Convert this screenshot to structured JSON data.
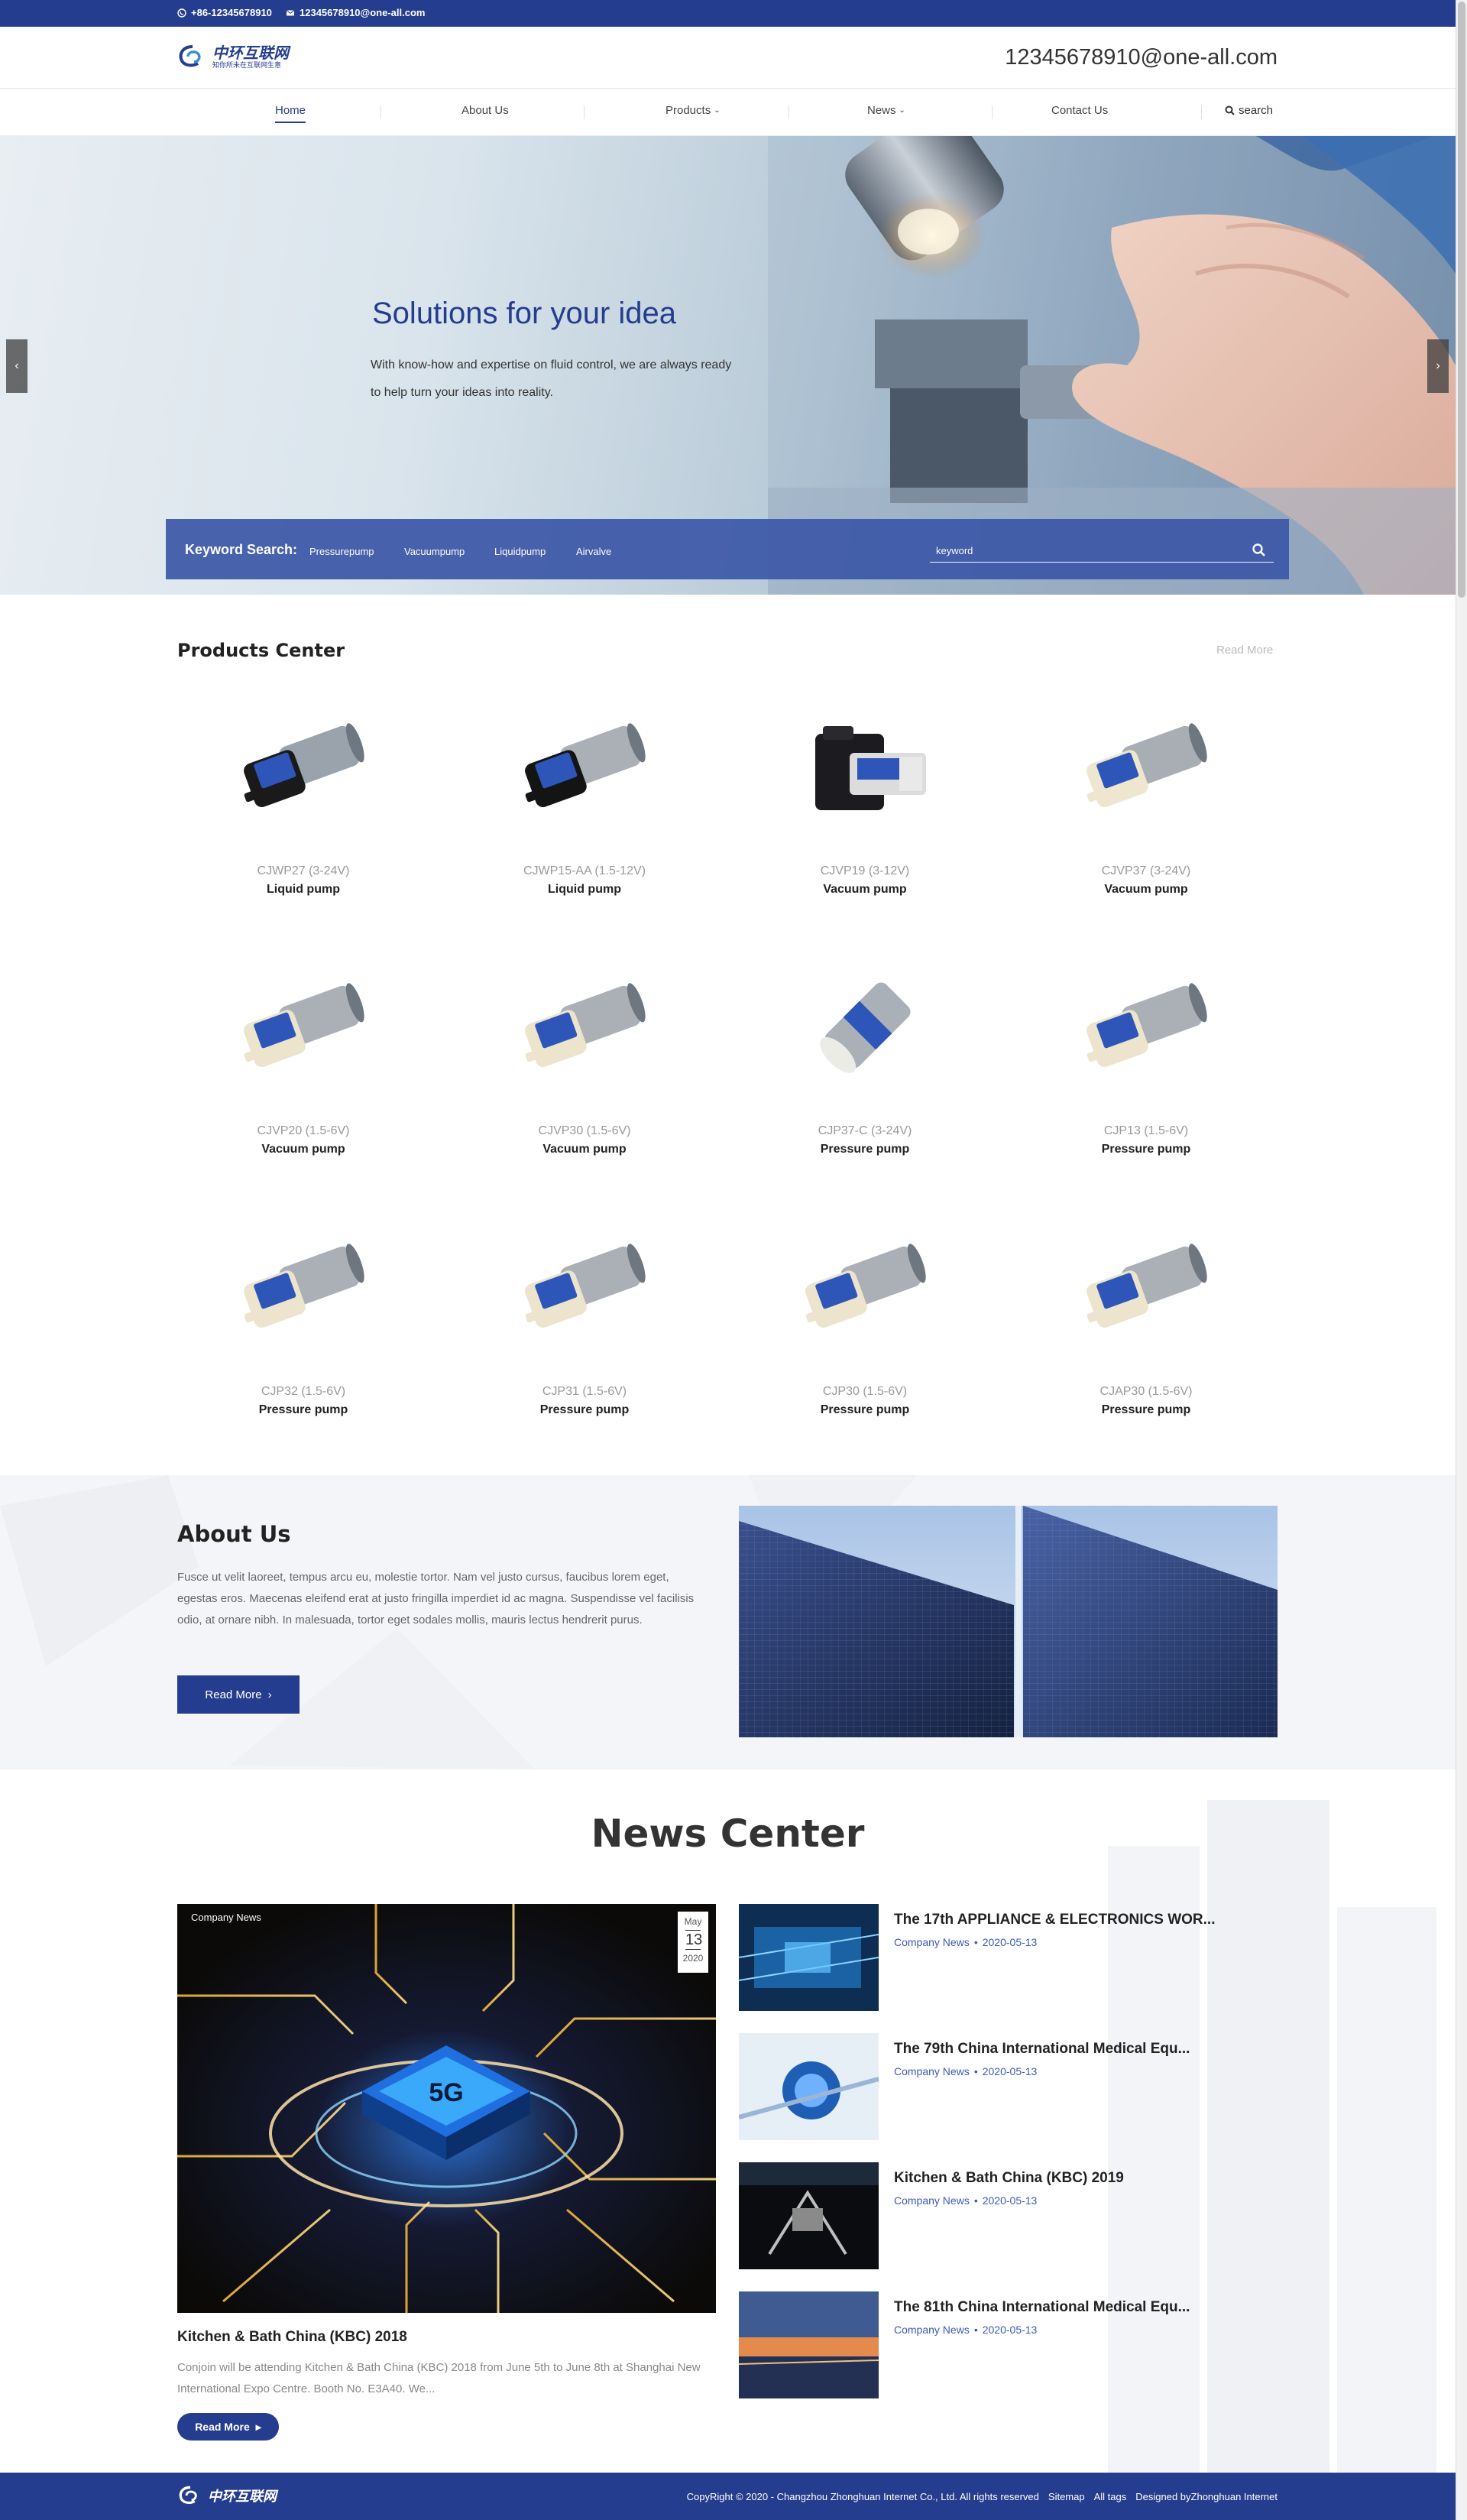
{
  "topbar": {
    "phone": "+86-12345678910",
    "email": "12345678910@one-all.com"
  },
  "header": {
    "logo_main": "中环互联网",
    "logo_sub": "知你所未在互联网生意",
    "email": "12345678910@one-all.com"
  },
  "nav": {
    "items": [
      {
        "label": "Home",
        "active": true
      },
      {
        "label": "About Us"
      },
      {
        "label": "Products",
        "has_dropdown": true
      },
      {
        "label": "News",
        "has_dropdown": true
      },
      {
        "label": "Contact Us"
      }
    ],
    "search_label": "search"
  },
  "hero": {
    "title": "Solutions for your idea",
    "text": "With know-how and expertise on fluid control, we are always ready to help turn your ideas into reality.",
    "keyword_label": "Keyword Search:",
    "keywords": [
      "Pressurepump",
      "Vacuumpump",
      "Liquidpump",
      "Airvalve"
    ],
    "search_placeholder": "keyword"
  },
  "products": {
    "title": "Products Center",
    "read_more": "Read More",
    "items": [
      {
        "model": "CJWP27 (3-24V)",
        "type": "Liquid pump"
      },
      {
        "model": "CJWP15-AA (1.5-12V)",
        "type": "Liquid pump"
      },
      {
        "model": "CJVP19 (3-12V)",
        "type": "Vacuum pump"
      },
      {
        "model": "CJVP37 (3-24V)",
        "type": "Vacuum pump"
      },
      {
        "model": "CJVP20 (1.5-6V)",
        "type": "Vacuum pump"
      },
      {
        "model": "CJVP30 (1.5-6V)",
        "type": "Vacuum pump"
      },
      {
        "model": "CJP37-C (3-24V)",
        "type": "Pressure pump"
      },
      {
        "model": "CJP13 (1.5-6V)",
        "type": "Pressure pump"
      },
      {
        "model": "CJP32 (1.5-6V)",
        "type": "Pressure pump"
      },
      {
        "model": "CJP31 (1.5-6V)",
        "type": "Pressure pump"
      },
      {
        "model": "CJP30 (1.5-6V)",
        "type": "Pressure pump"
      },
      {
        "model": "CJAP30 (1.5-6V)",
        "type": "Pressure pump"
      }
    ]
  },
  "about": {
    "title": "About Us",
    "text": "Fusce ut velit laoreet, tempus arcu eu, molestie tortor. Nam vel justo cursus, faucibus lorem eget, egestas eros. Maecenas eleifend erat at justo fringilla imperdiet id ac magna. Suspendisse vel facilisis odio, at ornare nibh. In malesuada, tortor eget sodales mollis, mauris lectus hendrerit purus.",
    "button": "Read More"
  },
  "news": {
    "title": "News Center",
    "featured": {
      "category": "Company News",
      "month": "May",
      "day": "13",
      "year": "2020",
      "title": "Kitchen & Bath China (KBC) 2018",
      "desc": "Conjoin will be attending Kitchen & Bath China (KBC) 2018 from June 5th to June 8th at Shanghai New International Expo Centre. Booth No. E3A40. We...",
      "button": "Read More"
    },
    "items": [
      {
        "title": "The 17th APPLIANCE & ELECTRONICS WOR...",
        "category": "Company News",
        "date": "2020-05-13"
      },
      {
        "title": "The 79th China International Medical Equ...",
        "category": "Company News",
        "date": "2020-05-13"
      },
      {
        "title": "Kitchen & Bath China (KBC) 2019",
        "category": "Company News",
        "date": "2020-05-13"
      },
      {
        "title": "The 81th China International Medical Equ...",
        "category": "Company News",
        "date": "2020-05-13"
      }
    ]
  },
  "footer": {
    "logo_main": "中环互联网",
    "copyright": "CopyRight © 2020 - Changzhou Zhonghuan Internet Co., Ltd.  All rights reserved",
    "sitemap": "Sitemap",
    "tags": "All tags",
    "designed": "Designed byZhonghuan Internet"
  },
  "colors": {
    "brand": "#253d8e",
    "accent": "#3b5bb5"
  }
}
